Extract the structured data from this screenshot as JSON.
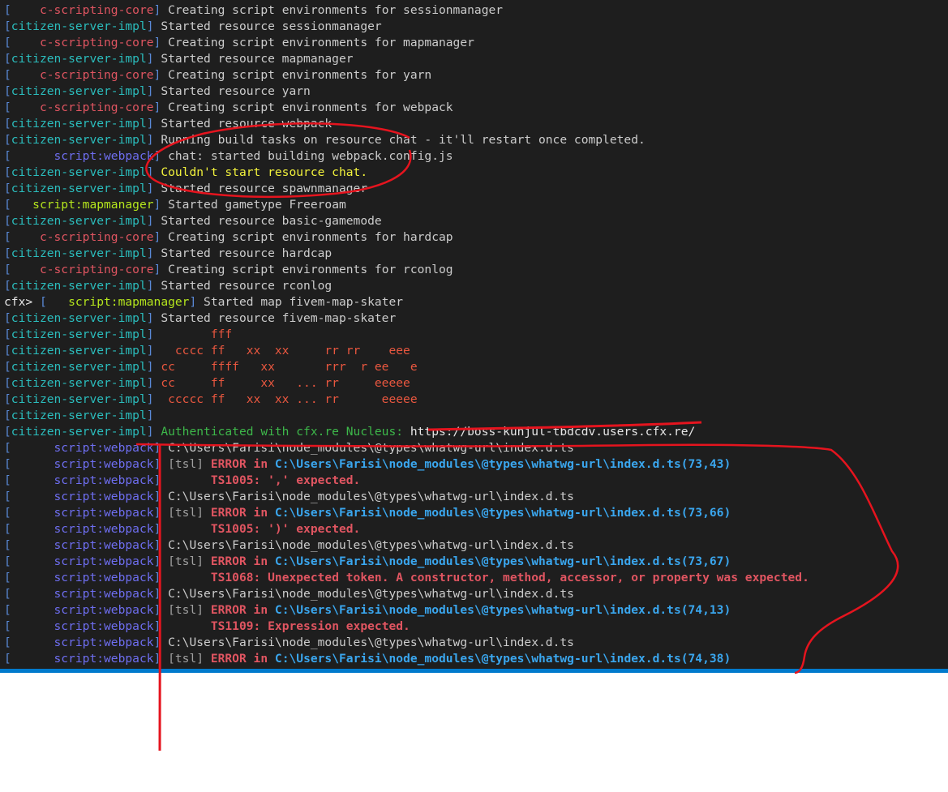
{
  "terminal": {
    "lines": [
      {
        "tag": "    c-scripting-core",
        "tag_color": "red",
        "msg": "Creating script environments for sessionmanager"
      },
      {
        "tag": "citizen-server-impl",
        "tag_color": "blue",
        "msg": "Started resource sessionmanager"
      },
      {
        "tag": "    c-scripting-core",
        "tag_color": "red",
        "msg": "Creating script environments for mapmanager"
      },
      {
        "tag": "citizen-server-impl",
        "tag_color": "blue",
        "msg": "Started resource mapmanager"
      },
      {
        "tag": "    c-scripting-core",
        "tag_color": "red",
        "msg": "Creating script environments for yarn"
      },
      {
        "tag": "citizen-server-impl",
        "tag_color": "blue",
        "msg": "Started resource yarn"
      },
      {
        "tag": "    c-scripting-core",
        "tag_color": "red",
        "msg": "Creating script environments for webpack"
      },
      {
        "tag": "citizen-server-impl",
        "tag_color": "blue",
        "msg": "Started resource webpack"
      },
      {
        "tag": "citizen-server-impl",
        "tag_color": "blue",
        "msg": "Running build tasks on resource chat - it'll restart once completed."
      },
      {
        "tag": "      script:webpack",
        "tag_color": "violet",
        "msg": "chat: started building webpack.config.js"
      },
      {
        "tag": "citizen-server-impl",
        "tag_color": "blue",
        "msg": "Couldn't start resource chat.",
        "msg_color": "yellow"
      },
      {
        "tag": "citizen-server-impl",
        "tag_color": "blue",
        "msg": "Started resource spawnmanager"
      },
      {
        "tag": "   script:mapmanager",
        "tag_color": "lime",
        "msg": "Started gametype Freeroam"
      },
      {
        "tag": "citizen-server-impl",
        "tag_color": "blue",
        "msg": "Started resource basic-gamemode"
      },
      {
        "tag": "    c-scripting-core",
        "tag_color": "red",
        "msg": "Creating script environments for hardcap"
      },
      {
        "tag": "citizen-server-impl",
        "tag_color": "blue",
        "msg": "Started resource hardcap"
      },
      {
        "tag": "    c-scripting-core",
        "tag_color": "red",
        "msg": "Creating script environments for rconlog"
      },
      {
        "tag": "citizen-server-impl",
        "tag_color": "blue",
        "msg": "Started resource rconlog"
      },
      {
        "prefix": "cfx> ",
        "tag": "   script:mapmanager",
        "tag_color": "lime",
        "msg": "Started map fivem-map-skater"
      },
      {
        "tag": "citizen-server-impl",
        "tag_color": "blue",
        "msg": "Started resource fivem-map-skater"
      },
      {
        "tag": "citizen-server-impl",
        "tag_color": "blue",
        "msg": "       fff",
        "msg_color": "orange"
      },
      {
        "tag": "citizen-server-impl",
        "tag_color": "blue",
        "msg": "  cccc ff   xx  xx     rr rr    eee",
        "msg_color": "orange"
      },
      {
        "tag": "citizen-server-impl",
        "tag_color": "blue",
        "msg": "cc     ffff   xx       rrr  r ee   e",
        "msg_color": "orange"
      },
      {
        "tag": "citizen-server-impl",
        "tag_color": "blue",
        "msg": "cc     ff     xx   ... rr     eeeee",
        "msg_color": "orange"
      },
      {
        "tag": "citizen-server-impl",
        "tag_color": "blue",
        "msg": " ccccc ff   xx  xx ... rr      eeeee",
        "msg_color": "orange"
      },
      {
        "tag": "citizen-server-impl",
        "tag_color": "blue",
        "msg": ""
      },
      {
        "tag": "citizen-server-impl",
        "tag_color": "blue",
        "msg": "Authenticated with cfx.re Nucleus: ",
        "msg_color": "green",
        "msg2": "https://boss-kunjul-tbdcdv.users.cfx.re/",
        "msg2_color": "white"
      },
      {
        "tag": "      script:webpack",
        "tag_color": "violet",
        "msg": "C:\\Users\\Farisi\\node_modules\\@types\\whatwg-url\\index.d.ts"
      },
      {
        "tag": "      script:webpack",
        "tag_color": "violet",
        "tsl": "[tsl] ",
        "err": "ERROR",
        "in": " in ",
        "path": "C:\\Users\\Farisi\\node_modules\\@types\\whatwg-url\\index.d.ts(73,43)"
      },
      {
        "tag": "      script:webpack",
        "tag_color": "violet",
        "errmsg": "      TS1005: ',' expected."
      },
      {
        "tag": "      script:webpack",
        "tag_color": "violet",
        "msg": "C:\\Users\\Farisi\\node_modules\\@types\\whatwg-url\\index.d.ts"
      },
      {
        "tag": "      script:webpack",
        "tag_color": "violet",
        "tsl": "[tsl] ",
        "err": "ERROR",
        "in": " in ",
        "path": "C:\\Users\\Farisi\\node_modules\\@types\\whatwg-url\\index.d.ts(73,66)"
      },
      {
        "tag": "      script:webpack",
        "tag_color": "violet",
        "errmsg": "      TS1005: ')' expected."
      },
      {
        "tag": "      script:webpack",
        "tag_color": "violet",
        "msg": "C:\\Users\\Farisi\\node_modules\\@types\\whatwg-url\\index.d.ts"
      },
      {
        "tag": "      script:webpack",
        "tag_color": "violet",
        "tsl": "[tsl] ",
        "err": "ERROR",
        "in": " in ",
        "path": "C:\\Users\\Farisi\\node_modules\\@types\\whatwg-url\\index.d.ts(73,67)"
      },
      {
        "tag": "      script:webpack",
        "tag_color": "violet",
        "errmsg": "      TS1068: Unexpected token. A constructor, method, accessor, or property was expected."
      },
      {
        "tag": "      script:webpack",
        "tag_color": "violet",
        "msg": "C:\\Users\\Farisi\\node_modules\\@types\\whatwg-url\\index.d.ts"
      },
      {
        "tag": "      script:webpack",
        "tag_color": "violet",
        "tsl": "[tsl] ",
        "err": "ERROR",
        "in": " in ",
        "path": "C:\\Users\\Farisi\\node_modules\\@types\\whatwg-url\\index.d.ts(74,13)"
      },
      {
        "tag": "      script:webpack",
        "tag_color": "violet",
        "errmsg": "      TS1109: Expression expected."
      },
      {
        "tag": "      script:webpack",
        "tag_color": "violet",
        "msg": "C:\\Users\\Farisi\\node_modules\\@types\\whatwg-url\\index.d.ts"
      },
      {
        "tag": "      script:webpack",
        "tag_color": "violet",
        "tsl": "[tsl] ",
        "err": "ERROR",
        "in": " in ",
        "path": "C:\\Users\\Farisi\\node_modules\\@types\\whatwg-url\\index.d.ts(74,38)"
      }
    ],
    "colors": {
      "background": "#1e1e1e",
      "bracket": "#5a8ad8",
      "red": "#e05561",
      "blue": "#2bbdbd",
      "violet": "#6e6ef0",
      "lime": "#b5e61d",
      "yellow": "#f2f23c",
      "green": "#3db84a",
      "orange": "#e9573f",
      "error_path": "#3aa6ee",
      "annotation": "#e5141e",
      "status_bar": "#007acc"
    }
  }
}
